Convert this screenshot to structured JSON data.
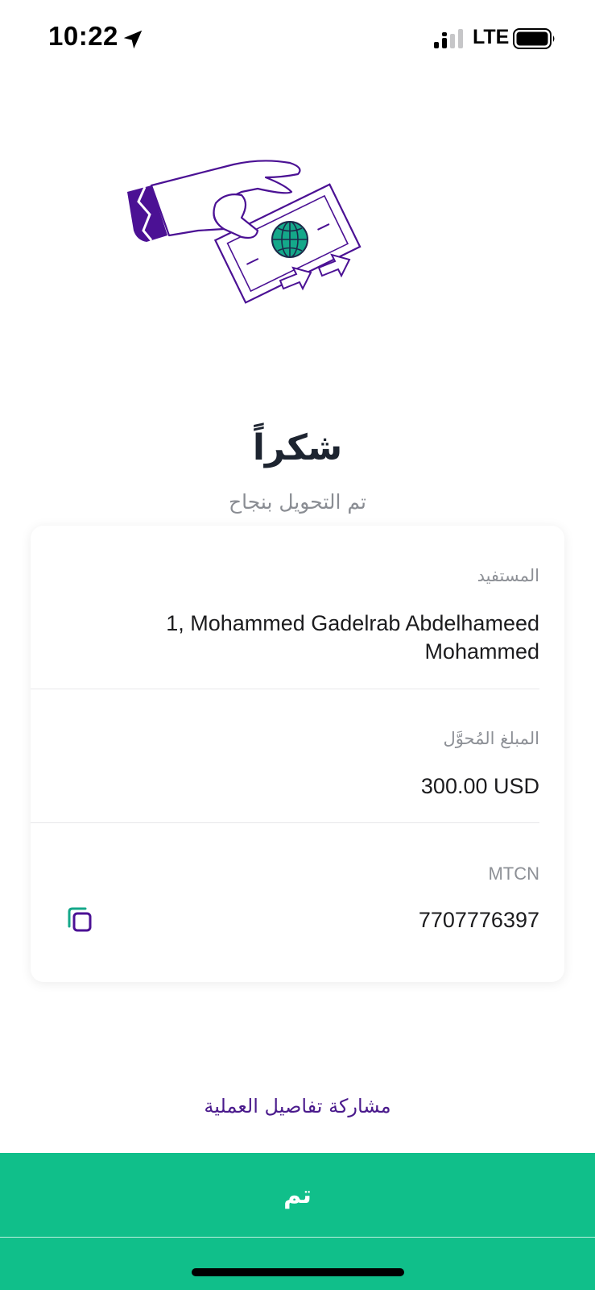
{
  "status_bar": {
    "time": "10:22",
    "network": "LTE",
    "icons": [
      "location-arrow-icon",
      "cellular-signal-icon",
      "battery-icon"
    ]
  },
  "illustration": {
    "icon": "hand-giving-money-icon"
  },
  "header": {
    "title": "شكراً",
    "subtitle": "تم التحويل بنجاح"
  },
  "details": {
    "beneficiary_label": "المستفيد",
    "beneficiary_value": "1, Mohammed Gadelrab Abdelhameed Mohammed",
    "amount_label": "المبلغ المُحوَّل",
    "amount_value": "300.00 USD",
    "mtcn_label": "MTCN",
    "mtcn_value": "7707776397",
    "copy_icon": "copy-icon"
  },
  "actions": {
    "share_label": "مشاركة تفاصيل العملية",
    "done_label": "تم"
  },
  "colors": {
    "accent_green": "#10bf8a",
    "brand_purple": "#4a1a8c",
    "title_text": "#1d2430",
    "secondary_text": "#8d9096"
  }
}
